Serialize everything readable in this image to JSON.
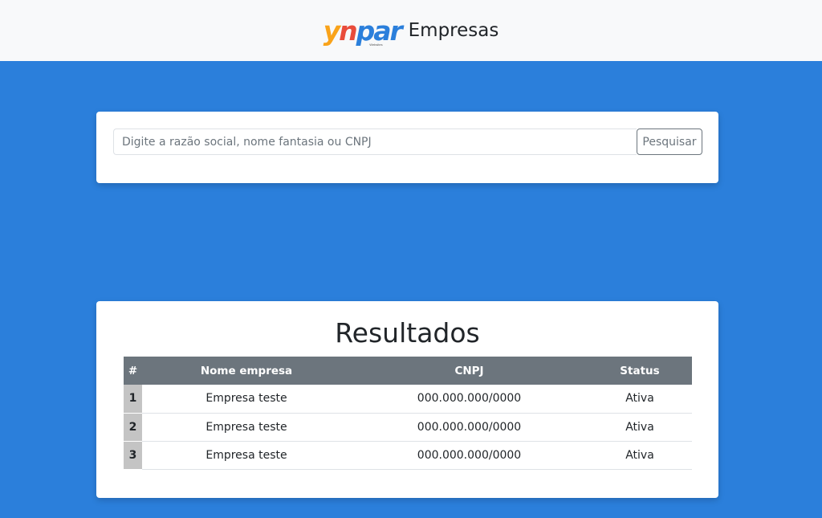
{
  "header": {
    "logo_parts": [
      "y",
      "n",
      "par"
    ],
    "logo_subtext": "Websites",
    "title": "Empresas",
    "colors": {
      "logo_yellow": "#f9a31a",
      "logo_red": "#e94c3b",
      "logo_blue": "#2b7fdb"
    }
  },
  "search": {
    "placeholder": "Digite a razão social, nome fantasia ou CNPJ",
    "value": "",
    "button_label": "Pesquisar"
  },
  "results": {
    "title": "Resultados",
    "columns": [
      "#",
      "Nome empresa",
      "CNPJ",
      "Status"
    ],
    "rows": [
      {
        "index": "1",
        "name": "Empresa teste",
        "cnpj": "000.000.000/0000",
        "status": "Ativa"
      },
      {
        "index": "2",
        "name": "Empresa teste",
        "cnpj": "000.000.000/0000",
        "status": "Ativa"
      },
      {
        "index": "3",
        "name": "Empresa teste",
        "cnpj": "000.000.000/0000",
        "status": "Ativa"
      }
    ]
  },
  "theme": {
    "background": "#2b7fdb",
    "header_bg": "#f8f9fa",
    "table_header_bg": "#6c757d"
  }
}
